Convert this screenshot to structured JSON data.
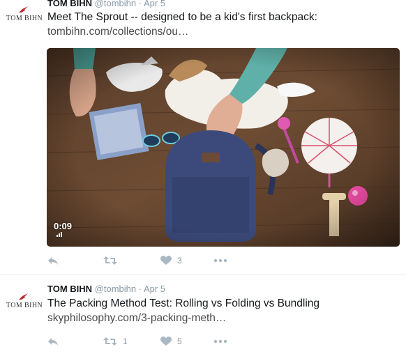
{
  "tweets": [
    {
      "author_name": "TOM BIHN",
      "handle": "@tombihn",
      "separator": "·",
      "date": "Apr 5",
      "logo_text": "TOM BIHN",
      "text": "Meet The Sprout -- designed to be a kid's first backpack:",
      "link": "tombihn.com/collections/ou…",
      "video_duration": "0:09",
      "retweets": "",
      "likes": "3"
    },
    {
      "author_name": "TOM BIHN",
      "handle": "@tombihn",
      "separator": "·",
      "date": "Apr 5",
      "logo_text": "TOM BIHN",
      "text": "The Packing Method Test: Rolling vs Folding vs Bundling",
      "link": "skyphilosophy.com/3-packing-meth…",
      "retweets": "1",
      "likes": "5"
    }
  ],
  "icons": {
    "reply": "reply-icon",
    "retweet": "retweet-icon",
    "like": "heart-icon",
    "more": "more-icon",
    "logo_bird": "bird-icon",
    "volume": "volume-icon"
  },
  "colors": {
    "action_gray": "#aab8c2",
    "meta_gray": "#8899a6",
    "text": "#14171a",
    "logo_red": "#c0262d"
  }
}
